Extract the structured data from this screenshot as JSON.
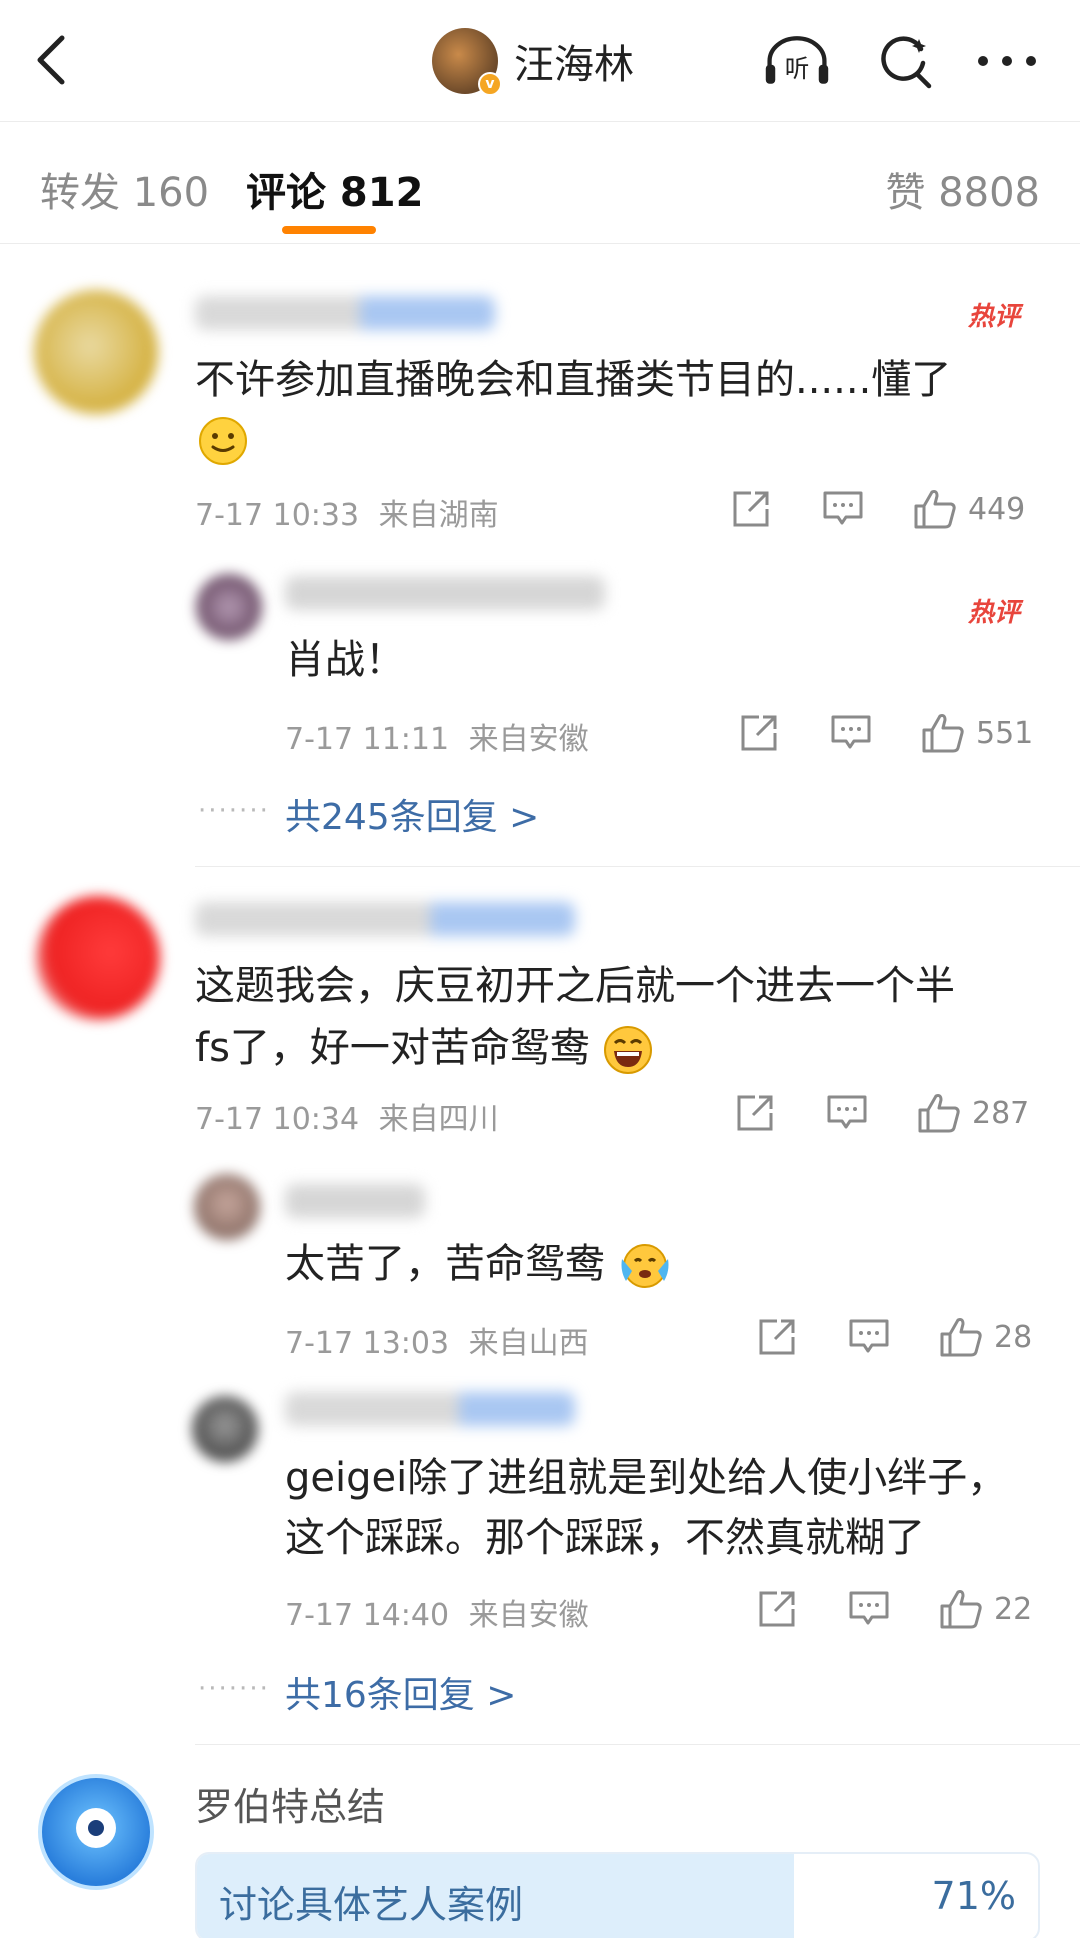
{
  "header": {
    "title": "汪海林",
    "listen_icon": "listen-icon",
    "search_icon": "search-icon",
    "more_icon": "more-icon"
  },
  "tabs": {
    "repost": "转发 160",
    "comment": "评论 812",
    "like": "赞 8808"
  },
  "hot_badge": "热评",
  "comments": [
    {
      "text_line1": "不许参加直播晚会和直播类节目的......懂了",
      "time": "7-17 10:33",
      "location": "来自湖南",
      "likes": "449",
      "reply": {
        "text": "肖战！",
        "time": "7-17 11:11",
        "location": "来自安徽",
        "likes": "551"
      },
      "more_replies": "共245条回复 >"
    },
    {
      "text_line1": "这题我会，庆豆初开之后就一个进去一个半",
      "text_line2": "fs了，好一对苦命鸳鸯",
      "time": "7-17 10:34",
      "location": "来自四川",
      "likes": "287",
      "replies": [
        {
          "text": "太苦了，苦命鸳鸯",
          "time": "7-17 13:03",
          "location": "来自山西",
          "likes": "28"
        },
        {
          "text_line1": "geigei除了进组就是到处给人使小绊子，",
          "text_line2": "这个踩踩。那个踩踩，不然真就糊了",
          "time": "7-17 14:40",
          "location": "来自安徽",
          "likes": "22"
        }
      ],
      "more_replies": "共16条回复 >"
    }
  ],
  "summary": {
    "name": "罗伯特总结",
    "poll_label": "讨论具体艺人案例",
    "poll_percent": "71%",
    "poll_fraction": 0.71
  },
  "dots": "·······"
}
